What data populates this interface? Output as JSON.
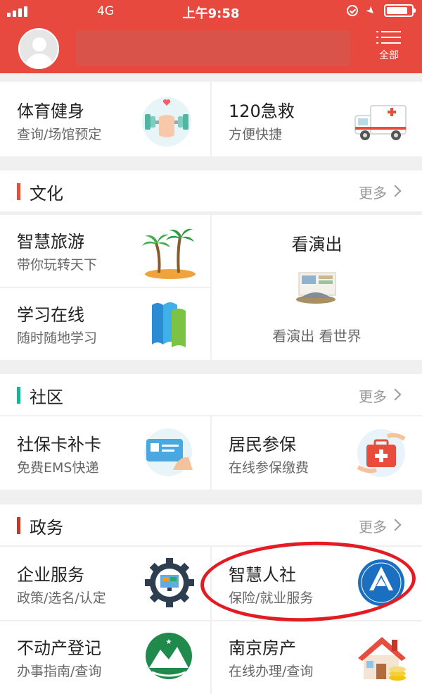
{
  "status_bar": {
    "network": "4G",
    "time": "上午9:58"
  },
  "header": {
    "menu_label": "全部"
  },
  "sports_row": [
    {
      "title": "体育健身",
      "subtitle": "查询/场馆预定",
      "icon": "fitness-icon"
    },
    {
      "title": "120急救",
      "subtitle": "方便快捷",
      "icon": "ambulance-icon"
    }
  ],
  "sections": {
    "culture": {
      "title": "文化",
      "more": "更多",
      "bar_color": "#e74c3c",
      "tiles": [
        {
          "title": "智慧旅游",
          "subtitle": "带你玩转天下",
          "icon": "palm-island-icon"
        },
        {
          "title": "学习在线",
          "subtitle": "随时随地学习",
          "icon": "books-icon"
        }
      ],
      "feature": {
        "title": "看演出",
        "subtitle": "看演出 看世界",
        "icon": "performance-tickets-icon"
      }
    },
    "community": {
      "title": "社区",
      "more": "更多",
      "bar_color": "#1ab394",
      "tiles": [
        {
          "title": "社保卡补卡",
          "subtitle": "免费EMS快递",
          "icon": "social-security-card-icon"
        },
        {
          "title": "居民参保",
          "subtitle": "在线参保缴费",
          "icon": "medical-kit-icon"
        }
      ]
    },
    "government": {
      "title": "政务",
      "more": "更多",
      "bar_color": "#c0392b",
      "tiles": [
        {
          "title": "企业服务",
          "subtitle": "政策/选名/认定",
          "icon": "enterprise-gear-icon"
        },
        {
          "title": "智慧人社",
          "subtitle": "保险/就业服务",
          "icon": "human-resources-logo-icon"
        },
        {
          "title": "不动产登记",
          "subtitle": "办事指南/查询",
          "icon": "real-estate-emblem-icon"
        },
        {
          "title": "南京房产",
          "subtitle": "在线办理/查询",
          "icon": "house-icon"
        }
      ]
    }
  },
  "colors": {
    "brand": "#e8493e",
    "highlight": "#e21c22"
  }
}
